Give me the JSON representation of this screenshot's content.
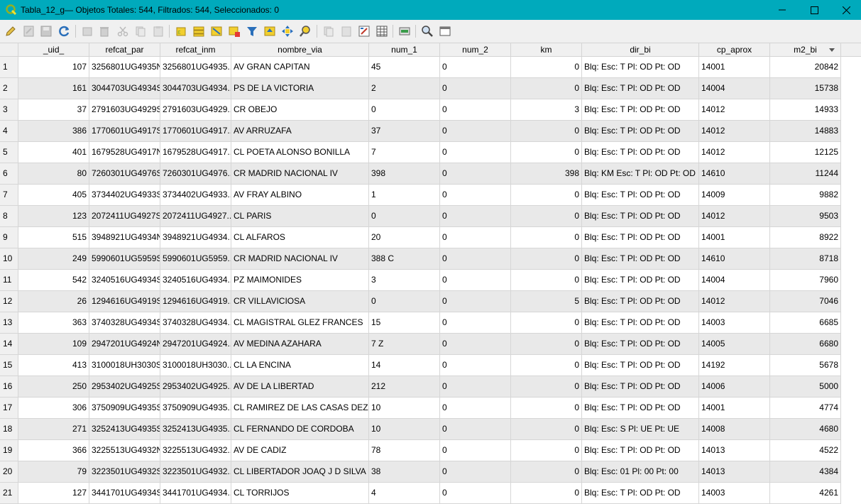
{
  "window": {
    "title": "Tabla_12_g— Objetos Totales: 544, Filtrados: 544, Seleccionados: 0",
    "minimize_icon": "minimize-icon",
    "maximize_icon": "maximize-icon",
    "close_icon": "close-icon"
  },
  "toolbar": {
    "icons": [
      "pencil-icon",
      "save-edits-icon",
      "save-icon",
      "refresh-icon",
      "add-feature-icon",
      "delete-icon",
      "cut-icon",
      "copy-icon",
      "paste-icon",
      "expression-select-icon",
      "select-all-icon",
      "invert-selection-icon",
      "deselect-icon",
      "filter-icon",
      "move-selection-top-icon",
      "pan-to-selection-icon",
      "zoom-to-selection-icon",
      "copy-rows-icon",
      "paste-rows-icon",
      "field-calculator-icon",
      "conditional-format-icon",
      "actions-icon",
      "zoom-icon",
      "dock-icon"
    ]
  },
  "table": {
    "columns": [
      "_uid_",
      "refcat_par",
      "refcat_inm",
      "nombre_via",
      "num_1",
      "num_2",
      "km",
      "dir_bi",
      "cp_aprox",
      "m2_bi"
    ],
    "sorted_column": "m2_bi",
    "rows": [
      [
        "1",
        "107",
        "3256801UG4935N",
        "3256801UG4935...",
        "AV GRAN CAPITAN",
        "45",
        "0",
        "0",
        "Blq:  Esc: T Pl: OD Pt: OD",
        "14001",
        "20842"
      ],
      [
        "2",
        "161",
        "3044703UG4934S",
        "3044703UG4934...",
        "PS DE LA VICTORIA",
        "2",
        "0",
        "0",
        "Blq:  Esc: T Pl: OD Pt: OD",
        "14004",
        "15738"
      ],
      [
        "3",
        "37",
        "2791603UG4929S",
        "2791603UG4929...",
        "CR OBEJO",
        "0",
        "0",
        "3",
        "Blq:  Esc: T Pl: OD Pt: OD",
        "14012",
        "14933"
      ],
      [
        "4",
        "386",
        "1770601UG4917S",
        "1770601UG4917...",
        "AV ARRUZAFA",
        "37",
        "0",
        "0",
        "Blq:  Esc: T Pl: OD Pt: OD",
        "14012",
        "14883"
      ],
      [
        "5",
        "401",
        "1679528UG4917N",
        "1679528UG4917...",
        "CL POETA ALONSO BONILLA",
        "7",
        "0",
        "0",
        "Blq:  Esc: T Pl: OD Pt: OD",
        "14012",
        "12125"
      ],
      [
        "6",
        "80",
        "7260301UG4976S",
        "7260301UG4976...",
        "CR MADRID NACIONAL IV",
        "398",
        "0",
        "398",
        "Blq: KM Esc: T Pl: OD Pt: OD",
        "14610",
        "11244"
      ],
      [
        "7",
        "405",
        "3734402UG4933S",
        "3734402UG4933...",
        "AV FRAY ALBINO",
        "1",
        "0",
        "0",
        "Blq:  Esc: T Pl: OD Pt: OD",
        "14009",
        "9882"
      ],
      [
        "8",
        "123",
        "2072411UG4927S",
        "2072411UG4927...",
        "CL PARIS",
        "0",
        "0",
        "0",
        "Blq:  Esc: T Pl: OD Pt: OD",
        "14012",
        "9503"
      ],
      [
        "9",
        "515",
        "3948921UG4934N",
        "3948921UG4934...",
        "CL ALFAROS",
        "20",
        "0",
        "0",
        "Blq:  Esc: T Pl: OD Pt: OD",
        "14001",
        "8922"
      ],
      [
        "10",
        "249",
        "5990601UG5959S",
        "5990601UG5959...",
        "CR MADRID NACIONAL IV",
        "388  C",
        "0",
        "0",
        "Blq:  Esc: T Pl: OD Pt: OD",
        "14610",
        "8718"
      ],
      [
        "11",
        "542",
        "3240516UG4934S",
        "3240516UG4934...",
        "PZ MAIMONIDES",
        "3",
        "0",
        "0",
        "Blq:  Esc: T Pl: OD Pt: OD",
        "14004",
        "7960"
      ],
      [
        "12",
        "26",
        "1294616UG4919S",
        "1294616UG4919...",
        "CR VILLAVICIOSA",
        "0",
        "0",
        "5",
        "Blq:  Esc: T Pl: OD Pt: OD",
        "14012",
        "7046"
      ],
      [
        "13",
        "363",
        "3740328UG4934S",
        "3740328UG4934...",
        "CL MAGISTRAL GLEZ FRANCES",
        "15",
        "0",
        "0",
        "Blq:  Esc: T Pl: OD Pt: OD",
        "14003",
        "6685"
      ],
      [
        "14",
        "109",
        "2947201UG4924N",
        "2947201UG4924...",
        "AV MEDINA AZAHARA",
        "7  Z",
        "0",
        "0",
        "Blq:  Esc: T Pl: OD Pt: OD",
        "14005",
        "6680"
      ],
      [
        "15",
        "413",
        "3100018UH3030S",
        "3100018UH3030...",
        "CL LA ENCINA",
        "14",
        "0",
        "0",
        "Blq:  Esc: T Pl: OD Pt: OD",
        "14192",
        "5678"
      ],
      [
        "16",
        "250",
        "2953402UG4925S",
        "2953402UG4925...",
        "AV DE LA LIBERTAD",
        "212",
        "0",
        "0",
        "Blq:  Esc: T Pl: OD Pt: OD",
        "14006",
        "5000"
      ],
      [
        "17",
        "306",
        "3750909UG4935S",
        "3750909UG4935...",
        "CL RAMIREZ DE LAS CASAS DEZA",
        "10",
        "0",
        "0",
        "Blq:  Esc: T Pl: OD Pt: OD",
        "14001",
        "4774"
      ],
      [
        "18",
        "271",
        "3252413UG4935S",
        "3252413UG4935...",
        "CL FERNANDO DE CORDOBA",
        "10",
        "0",
        "0",
        "Blq:  Esc: S Pl: UE Pt: UE",
        "14008",
        "4680"
      ],
      [
        "19",
        "366",
        "3225513UG4932N",
        "3225513UG4932...",
        "AV DE CADIZ",
        "78",
        "0",
        "0",
        "Blq:  Esc: T Pl: OD Pt: OD",
        "14013",
        "4522"
      ],
      [
        "20",
        "79",
        "3223501UG4932S",
        "3223501UG4932...",
        "CL LIBERTADOR JOAQ J D SILVA",
        "38",
        "0",
        "0",
        "Blq:  Esc: 01 Pl: 00 Pt: 00",
        "14013",
        "4384"
      ],
      [
        "21",
        "127",
        "3441701UG4934S",
        "3441701UG4934...",
        "CL TORRIJOS",
        "4",
        "0",
        "0",
        "Blq:  Esc: T Pl: OD Pt: OD",
        "14003",
        "4261"
      ]
    ]
  }
}
